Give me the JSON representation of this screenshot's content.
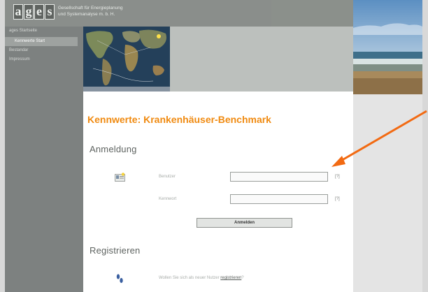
{
  "header": {
    "logo_letters": [
      "a",
      "g",
      "e",
      "s"
    ],
    "company_line1": "Gesellschaft für Energieplanung",
    "company_line2": "und Systemanalyse m. b. H."
  },
  "sidebar": {
    "items": [
      {
        "label": "ages Startseite"
      },
      {
        "label": "Kennwerte Start"
      },
      {
        "label": "Bestandar"
      },
      {
        "label": "Impressum"
      }
    ]
  },
  "main": {
    "page_title": "Kennwerte: Krankenhäuser-Benchmark",
    "login": {
      "heading": "Anmeldung",
      "user_label": "Benutzer",
      "user_value": "",
      "user_help": "[?]",
      "password_label": "Kennwort",
      "password_value": "",
      "password_help": "[?]",
      "submit_label": "Anmelden"
    },
    "register": {
      "heading": "Registrieren",
      "text": "Wollen Sie sich als neuer Nutzer",
      "link_label": "registrieren",
      "suffix": "?"
    }
  },
  "colors": {
    "accent": "#f08a10",
    "arrow": "#f26a12",
    "sidebar": "#7d8180",
    "banner": "#8a8e8b"
  },
  "icons": [
    "login-card-icon",
    "footprints-icon",
    "pointer-arrow"
  ]
}
